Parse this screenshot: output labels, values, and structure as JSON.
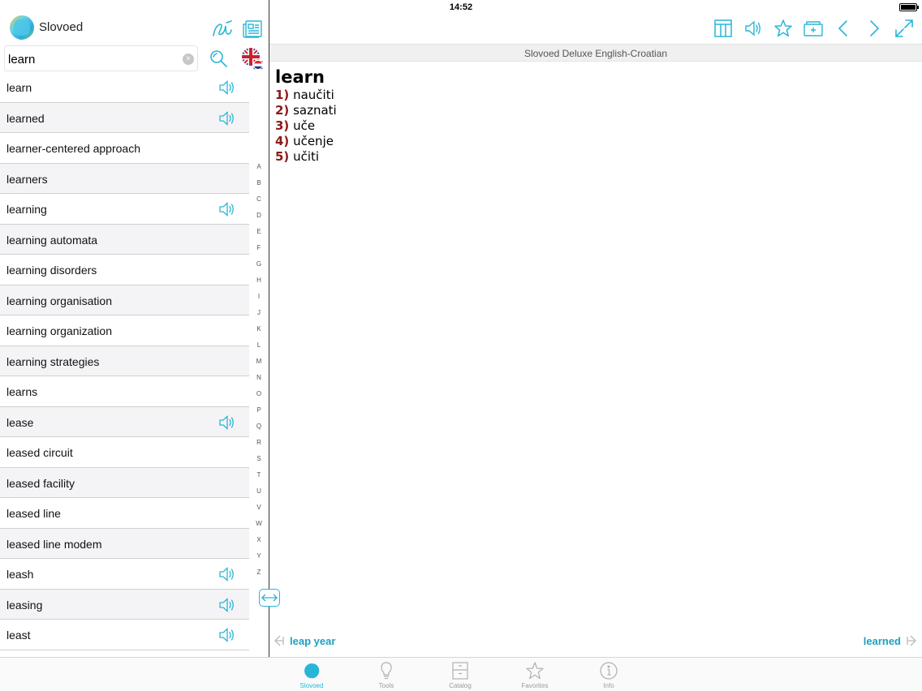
{
  "status_bar": {
    "time": "14:52"
  },
  "app": {
    "name": "Slovoed"
  },
  "search": {
    "value": "learn",
    "clear_glyph": "×"
  },
  "word_list": [
    {
      "word": "learn",
      "audio": true
    },
    {
      "word": "learned",
      "audio": true
    },
    {
      "word": "learner-centered approach",
      "audio": false
    },
    {
      "word": "learners",
      "audio": false
    },
    {
      "word": "learning",
      "audio": true
    },
    {
      "word": "learning automata",
      "audio": false
    },
    {
      "word": "learning disorders",
      "audio": false
    },
    {
      "word": "learning organisation",
      "audio": false
    },
    {
      "word": "learning organization",
      "audio": false
    },
    {
      "word": "learning strategies",
      "audio": false
    },
    {
      "word": "learns",
      "audio": false
    },
    {
      "word": "lease",
      "audio": true
    },
    {
      "word": "leased circuit",
      "audio": false
    },
    {
      "word": "leased facility",
      "audio": false
    },
    {
      "word": "leased line",
      "audio": false
    },
    {
      "word": "leased line modem",
      "audio": false
    },
    {
      "word": "leash",
      "audio": true
    },
    {
      "word": "leasing",
      "audio": true
    },
    {
      "word": "least",
      "audio": true
    }
  ],
  "alphabet": [
    "A",
    "B",
    "C",
    "D",
    "E",
    "F",
    "G",
    "H",
    "I",
    "J",
    "K",
    "L",
    "M",
    "N",
    "O",
    "P",
    "Q",
    "R",
    "S",
    "T",
    "U",
    "V",
    "W",
    "X",
    "Y",
    "Z"
  ],
  "dictionary_title": "Slovoed Deluxe English-Croatian",
  "entry": {
    "headword": "learn",
    "senses": [
      {
        "num": "1)",
        "text": "naučiti"
      },
      {
        "num": "2)",
        "text": "saznati"
      },
      {
        "num": "3)",
        "text": "uče"
      },
      {
        "num": "4)",
        "text": "učenje"
      },
      {
        "num": "5)",
        "text": "učiti"
      }
    ]
  },
  "navigation": {
    "prev": "leap year",
    "next": "learned"
  },
  "tabs": [
    {
      "label": "Slovoed",
      "icon": "slovoed-logo-icon",
      "active": true
    },
    {
      "label": "Tools",
      "icon": "lightbulb-icon",
      "active": false
    },
    {
      "label": "Catalog",
      "icon": "cabinet-icon",
      "active": false
    },
    {
      "label": "Favorites",
      "icon": "star-icon",
      "active": false
    },
    {
      "label": "Info",
      "icon": "info-icon",
      "active": false
    }
  ],
  "colors": {
    "accent": "#29b6d6",
    "sense_number": "#8b1a1a",
    "link": "#1c9fc4"
  }
}
